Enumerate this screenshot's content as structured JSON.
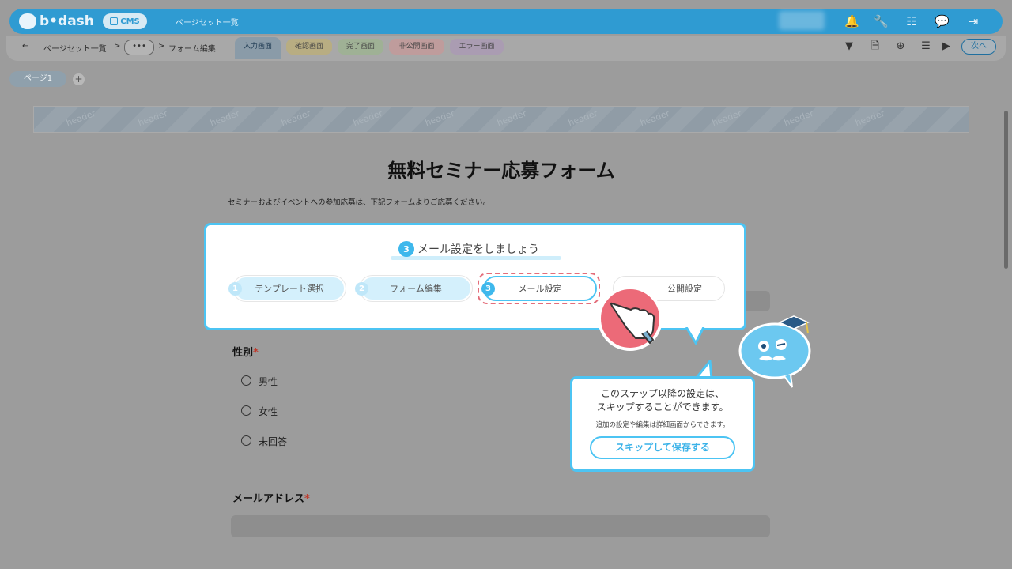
{
  "app": {
    "logo_text": "b•dash",
    "cms_label": "CMS",
    "nav_title": "ページセット一覧"
  },
  "header_icons": [
    "bell-icon",
    "wrench-icon",
    "grid-icon",
    "chat-icon",
    "logout-icon"
  ],
  "breadcrumb": {
    "back": "←",
    "items": [
      "ページセット一覧",
      ">",
      "•••",
      ">",
      "フォーム編集"
    ]
  },
  "tabs": [
    {
      "label": "入力画面",
      "color": "#8a9ba8"
    },
    {
      "label": "確認画面",
      "color": "#b8ad82"
    },
    {
      "label": "完了画面",
      "color": "#9fb195"
    },
    {
      "label": "非公開画面",
      "color": "#bf9c9c"
    },
    {
      "label": "エラー画面",
      "color": "#aa9cb2"
    }
  ],
  "toolbar_right": {
    "next_label": "次へ"
  },
  "page_tab": {
    "label": "ページ1",
    "add": "+"
  },
  "canvas": {
    "header_text": "header",
    "form_title": "無料セミナー応募フォーム",
    "description": "セミナーおよびイベントへの参加応募は、下記フォームよりご応募ください。",
    "gender_label": "性別",
    "required_mark": "*",
    "options": [
      "男性",
      "女性",
      "未回答"
    ],
    "email_label": "メールアドレス"
  },
  "guide": {
    "current_num": "3",
    "title": "メール設定をしましょう",
    "steps": [
      {
        "num": "1",
        "label": "テンプレート選択"
      },
      {
        "num": "2",
        "label": "フォーム編集"
      },
      {
        "num": "3",
        "label": "メール設定"
      },
      {
        "num": "",
        "label": "公開設定"
      }
    ]
  },
  "tooltip": {
    "line1": "このステップ以降の設定は、",
    "line2": "スキップすることができます。",
    "note": "追加の設定や編集は詳細画面からできます。",
    "button": "スキップして保存する"
  },
  "colors": {
    "accent": "#4cc4f3",
    "dash": "#e46d7a",
    "topbar": "#2f9bd2"
  }
}
